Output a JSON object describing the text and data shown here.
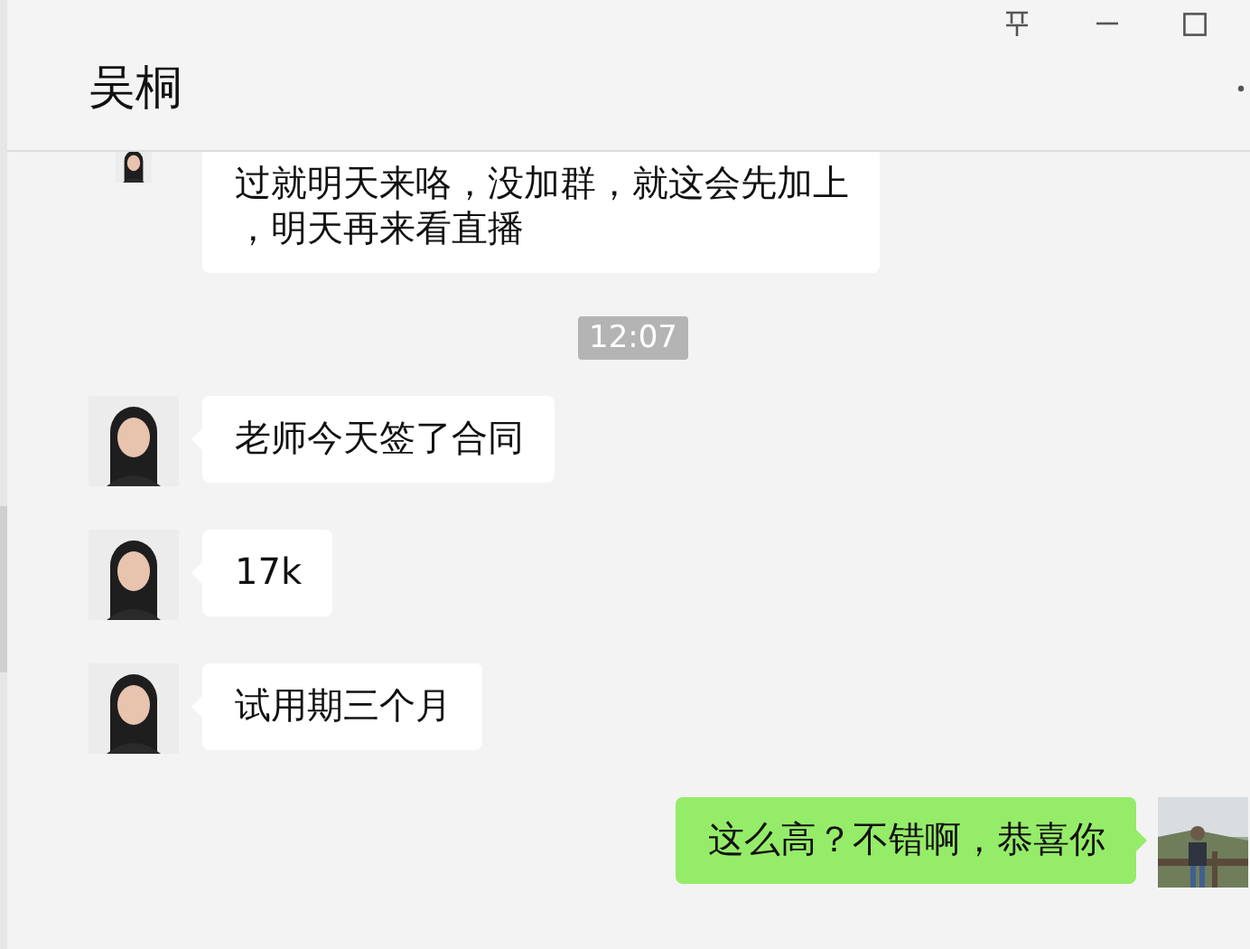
{
  "chat": {
    "title": "吴桐"
  },
  "messages": [
    {
      "kind": "incoming",
      "lines": [
        "过就明天来咯，没加群，就这会先加上",
        "，明天再来看直播"
      ]
    },
    {
      "kind": "time",
      "text": "12:07"
    },
    {
      "kind": "incoming",
      "lines": [
        "老师今天签了合同"
      ]
    },
    {
      "kind": "incoming",
      "lines": [
        "17k"
      ]
    },
    {
      "kind": "incoming",
      "lines": [
        "试用期三个月"
      ]
    },
    {
      "kind": "outgoing",
      "lines": [
        "这么高？不错啊，恭喜你"
      ]
    }
  ]
}
